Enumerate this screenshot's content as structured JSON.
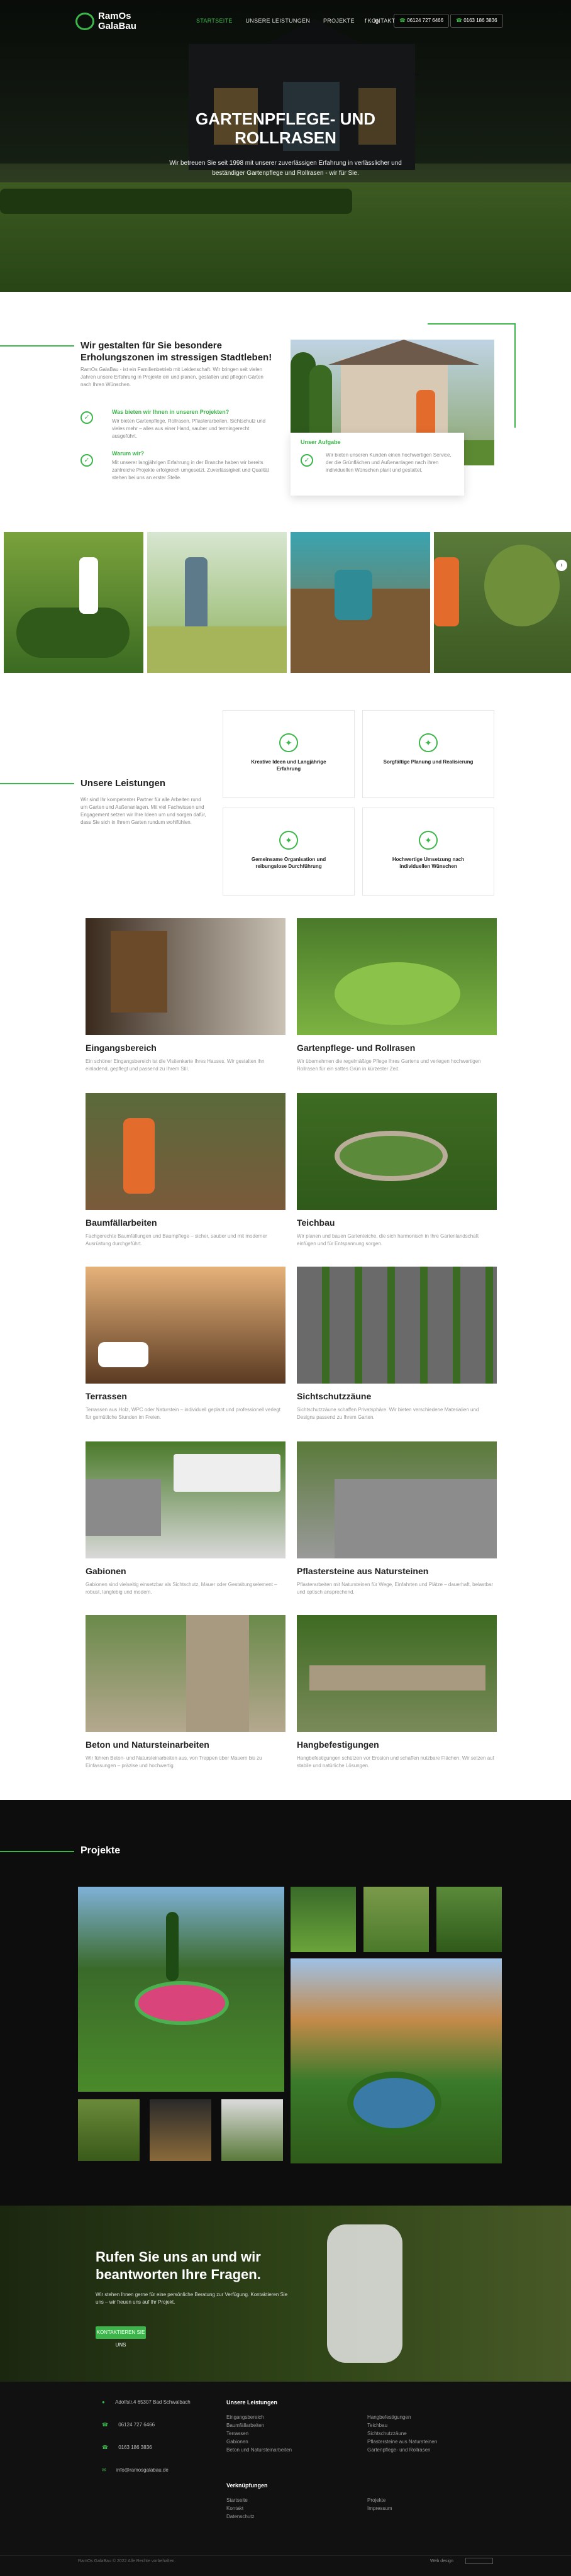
{
  "brand": {
    "line1": "RamOs",
    "line2": "GalaBau",
    "accent": "#3cb54a"
  },
  "nav": {
    "items": [
      "STARTSEITE",
      "UNSERE LEISTUNGEN",
      "PROJEKTE",
      "KONTAKT"
    ],
    "phone1": "06124 727 6466",
    "phone2": "0163 186 3836",
    "social": [
      "f",
      "ig"
    ]
  },
  "hero": {
    "title": "GARTENPFLEGE- UND ROLLRASEN",
    "subtitle": "Wir betreuen Sie seit 1998 mit unserer zuverlässigen Erfahrung in verlässlicher und beständiger Gartenpflege und Rollrasen - wir für Sie."
  },
  "intro": {
    "title": "Wir gestalten für Sie besondere Erholungszonen im stressigen Stadtleben!",
    "text": "RamOs GalaBau - ist ein Familienbetrieb mit Leidenschaft. Wir bringen seit vielen Jahren unsere Erfahrung in Projekte ein und planen, gestalten und pflegen Gärten nach Ihren Wünschen.",
    "q1": "Was bieten wir Ihnen in unseren Projekten?",
    "a1": "Wir bieten Gartenpflege, Rollrasen, Pflasterarbeiten, Sichtschutz und vieles mehr – alles aus einer Hand, sauber und termingerecht ausgeführt.",
    "q2": "Warum wir?",
    "a2": "Mit unserer langjährigen Erfahrung in der Branche haben wir bereits zahlreiche Projekte erfolgreich umgesetzt. Zuverlässigkeit und Qualität stehen bei uns an erster Stelle.",
    "goal_title": "Unser Aufgabe",
    "goal_text": "Wir bieten unseren Kunden einen hochwertigen Service, der die Grünflächen und Außenanlagen nach ihren individuellen Wünschen plant und gestaltet."
  },
  "leistungen": {
    "title": "Unsere Leistungen",
    "text": "Wir sind Ihr kompetenter Partner für alle Arbeiten rund um Garten und Außenanlagen. Mit viel Fachwissen und Engagement setzen wir Ihre Ideen um und sorgen dafür, dass Sie sich in Ihrem Garten rundum wohlfühlen.",
    "features": [
      {
        "label": "Kreative Ideen und Langjährige Erfahrung",
        "icon": "lightbulb-icon"
      },
      {
        "label": "Sorgfältige Planung und Realisierung",
        "icon": "handshake-icon"
      },
      {
        "label": "Gemeinsame Organisation und reibungslose Durchführung",
        "icon": "team-icon"
      },
      {
        "label": "Hochwertige Umsetzung nach individuellen Wünschen",
        "icon": "star-icon"
      }
    ],
    "services": [
      {
        "title": "Eingangsbereich",
        "desc": "Ein schöner Eingangsbereich ist die Visitenkarte Ihres Hauses. Wir gestalten ihn einladend, gepflegt und passend zu Ihrem Stil."
      },
      {
        "title": "Gartenpflege- und Rollrasen",
        "desc": "Wir übernehmen die regelmäßige Pflege Ihres Gartens und verlegen hochwertigen Rollrasen für ein sattes Grün in kürzester Zeit."
      },
      {
        "title": "Baumfällarbeiten",
        "desc": "Fachgerechte Baumfällungen und Baumpflege – sicher, sauber und mit moderner Ausrüstung durchgeführt."
      },
      {
        "title": "Teichbau",
        "desc": "Wir planen und bauen Gartenteiche, die sich harmonisch in Ihre Gartenlandschaft einfügen und für Entspannung sorgen."
      },
      {
        "title": "Terrassen",
        "desc": "Terrassen aus Holz, WPC oder Naturstein – individuell geplant und professionell verlegt für gemütliche Stunden im Freien."
      },
      {
        "title": "Sichtschutzzäune",
        "desc": "Sichtschutzzäune schaffen Privatsphäre. Wir bieten verschiedene Materialien und Designs passend zu Ihrem Garten."
      },
      {
        "title": "Gabionen",
        "desc": "Gabionen sind vielseitig einsetzbar als Sichtschutz, Mauer oder Gestaltungselement – robust, langlebig und modern."
      },
      {
        "title": "Pflastersteine aus Natursteinen",
        "desc": "Pflasterarbeiten mit Natursteinen für Wege, Einfahrten und Plätze – dauerhaft, belastbar und optisch ansprechend."
      },
      {
        "title": "Beton und Natursteinarbeiten",
        "desc": "Wir führen Beton- und Natursteinarbeiten aus, von Treppen über Mauern bis zu Einfassungen – präzise und hochwertig."
      },
      {
        "title": "Hangbefestigungen",
        "desc": "Hangbefestigungen schützen vor Erosion und schaffen nutzbare Flächen. Wir setzen auf stabile und natürliche Lösungen."
      }
    ]
  },
  "projekte": {
    "title": "Projekte"
  },
  "cta": {
    "title": "Rufen Sie uns an und wir beantworten Ihre Fragen.",
    "text": "Wir stehen Ihnen gerne für eine persönliche Beratung zur Verfügung. Kontaktieren Sie uns – wir freuen uns auf Ihr Projekt.",
    "button": "KONTAKTIEREN SIE UNS"
  },
  "footer": {
    "address": "Adolfstr.4 65307 Bad Schwalbach",
    "phone1": "06124 727 6466",
    "phone2": "0163 186 3836",
    "email": "info@ramosgalabau.de",
    "leistungen_title": "Unsere Leistungen",
    "col1": [
      "Eingangsbereich",
      "Baumfällarbeiten",
      "Terrassen",
      "Gabionen",
      "Beton und Natursteinarbeiten"
    ],
    "col2": [
      "Hangbefestigungen",
      "Teichbau",
      "Sichtschutzzäune",
      "Pflastersteine aus Natursteinen",
      "Gartenpflege- und Rollrasen"
    ],
    "links_title": "Verknüpfungen",
    "links1": [
      "Startseite",
      "Kontakt",
      "Datenschutz"
    ],
    "links2": [
      "Projekte",
      "Impressum"
    ],
    "copyright": "RamOs GalaBau © 2022 Alle Rechte vorbehalten.",
    "made_by": "Web design"
  }
}
